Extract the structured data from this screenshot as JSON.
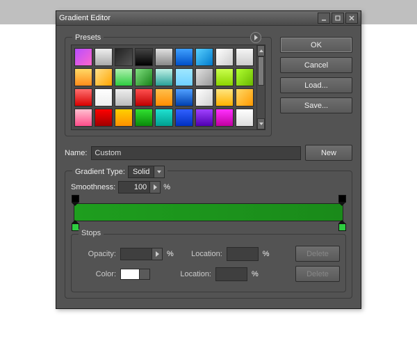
{
  "window": {
    "title": "Gradient Editor"
  },
  "buttons": {
    "ok": "OK",
    "cancel": "Cancel",
    "load": "Load...",
    "save": "Save...",
    "new": "New",
    "delete": "Delete"
  },
  "presets_label": "Presets",
  "name": {
    "label": "Name:",
    "value": "Custom"
  },
  "gradient_type": {
    "label": "Gradient Type:",
    "value": "Solid"
  },
  "smoothness": {
    "label": "Smoothness:",
    "value": "100",
    "unit": "%"
  },
  "stops_label": "Stops",
  "stop_fields": {
    "opacity_label": "Opacity:",
    "opacity_value": "",
    "opacity_unit": "%",
    "color_label": "Color:",
    "location_label": "Location:",
    "location1_value": "",
    "location2_value": "",
    "location_unit": "%"
  },
  "gradient": {
    "start": "#1e9e1e",
    "end": "#1a8a1a"
  },
  "preset_swatches": [
    "linear-gradient(135deg,#b84dff,#ff66cc)",
    "linear-gradient(#eee,#aaa)",
    "linear-gradient(135deg,#222,#555)",
    "linear-gradient(#444,#000)",
    "linear-gradient(#e0e0e0,#888)",
    "linear-gradient(#3fa0ff,#0050c8)",
    "linear-gradient(135deg,#59d0ff,#007acc)",
    "linear-gradient(135deg,#fff,#ccc)",
    "linear-gradient(#f5f5f5,#ccc)",
    "linear-gradient(#ffd966,#ff8c1a)",
    "linear-gradient(135deg,#ffe08a,#ffa500)",
    "linear-gradient(#aef0ae,#2ecc40)",
    "linear-gradient(135deg,#7fe07f,#188018)",
    "linear-gradient(#c0f0e6,#2aa198)",
    "linear-gradient(#9fe8ff,#6fd0ff)",
    "linear-gradient(135deg,#e0e0e0,#999)",
    "linear-gradient(#caff4d,#8cd400)",
    "linear-gradient(135deg,#b0ff30,#6ab800)",
    "linear-gradient(#ff7070,#d80000)",
    "linear-gradient(#fff,#eee)",
    "linear-gradient(#eee,#bbb)",
    "linear-gradient(#ff5050,#c00000)",
    "linear-gradient(#ffc04d,#ff8c00)",
    "linear-gradient(#50a0ff,#0040b0)",
    "linear-gradient(135deg,#fff,#d0d0d0)",
    "linear-gradient(#ffe680,#ffb000)",
    "linear-gradient(135deg,#ffd966,#ff9900)",
    "linear-gradient(#ffc0d0,#ff4d8a)",
    "linear-gradient(#ff0000,#a00000)",
    "linear-gradient(#ffd000,#ff9000)",
    "linear-gradient(#30e030,#0a8a0a)",
    "linear-gradient(#20e0d0,#00a090)",
    "linear-gradient(#3060ff,#0030c0)",
    "linear-gradient(#a040ff,#5000b0)",
    "linear-gradient(#ff30ff,#c000a0)",
    "linear-gradient(#ffffff,#dddddd)"
  ]
}
